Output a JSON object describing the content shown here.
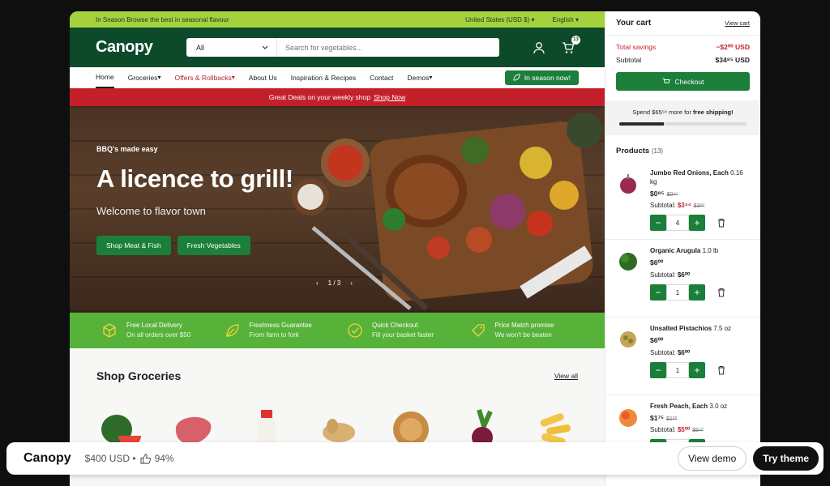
{
  "topbar": {
    "promo": "In Season Browse the best in seasonal flavour",
    "region": "United States (USD $)",
    "language": "English"
  },
  "header": {
    "logo": "Canopy",
    "search_category": "All",
    "search_placeholder": "Search for vegetables...",
    "cart_count": "13"
  },
  "nav": {
    "items": [
      "Home",
      "Groceries",
      "Offers & Rollbacks",
      "About Us",
      "Inspiration & Recipes",
      "Contact",
      "Demos"
    ],
    "season_button": "In season now!"
  },
  "deals": {
    "text": "Great Deals on your weekly shop",
    "link": "Shop Now"
  },
  "hero": {
    "eyebrow": "BBQ's made easy",
    "title": "A licence to grill!",
    "subtitle": "Welcome to flavor town",
    "btn1": "Shop Meat & Fish",
    "btn2": "Fresh Vegetables",
    "pager": "1 / 3"
  },
  "features": [
    {
      "title": "Free Local Delivery",
      "sub": "On all orders over $50"
    },
    {
      "title": "Freshness Guarantee",
      "sub": "From farm to fork"
    },
    {
      "title": "Quick Checkout",
      "sub": "Fill your basket faster"
    },
    {
      "title": "Price Match promise",
      "sub": "We won't be beaten"
    }
  ],
  "groceries": {
    "title": "Shop Groceries",
    "link": "View all"
  },
  "cart": {
    "title": "Your cart",
    "view": "View cart",
    "savings_label": "Total savings",
    "savings_value": "−$2⁰⁰ USD",
    "subtotal_label": "Subtotal",
    "subtotal_value": "$34⁸⁵ USD",
    "checkout": "Checkout",
    "ship_pre": "Spend $65⁵⁸ more for ",
    "ship_bold": "free shipping!",
    "ship_progress": 0.35,
    "products_label": "Products",
    "products_count": "(13)",
    "products": [
      {
        "name": "Jumbo Red Onions, Each",
        "weight": "0.16 kg",
        "price": "$0⁸⁵",
        "old": "$0⁹⁵",
        "subtotal_label": "Subtotal:",
        "subtotal": "$3⁴⁴",
        "sub_old": "$3⁸⁰",
        "qty": "4"
      },
      {
        "name": "Organic Arugula",
        "weight": "1.0 lb",
        "price": "$6⁰⁰",
        "old": "",
        "subtotal_label": "Subtotal:",
        "subtotal": "$6⁰⁰",
        "sub_old": "",
        "qty": "1"
      },
      {
        "name": "Unsalted Pistachios",
        "weight": "7.5 oz",
        "price": "$6⁰⁰",
        "old": "",
        "subtotal_label": "Subtotal:",
        "subtotal": "$6⁰⁰",
        "sub_old": "",
        "qty": "1"
      },
      {
        "name": "Fresh Peach, Each",
        "weight": "3.0 oz",
        "price": "$1⁷⁵",
        "old": "$1⁰⁰",
        "subtotal_label": "Subtotal:",
        "subtotal": "$5⁰⁰",
        "sub_old": "$5⁵⁰",
        "qty": "1"
      }
    ]
  },
  "overlay": {
    "brand": "Canopy",
    "price": "$400 USD •",
    "rating": "94%",
    "demo": "View demo",
    "try": "Try theme"
  },
  "colors": {
    "dark_green": "#0d4a2a",
    "green": "#1b7f3a",
    "lime": "#a6d13f",
    "red": "#c4202a",
    "feature_green": "#57b23a"
  }
}
